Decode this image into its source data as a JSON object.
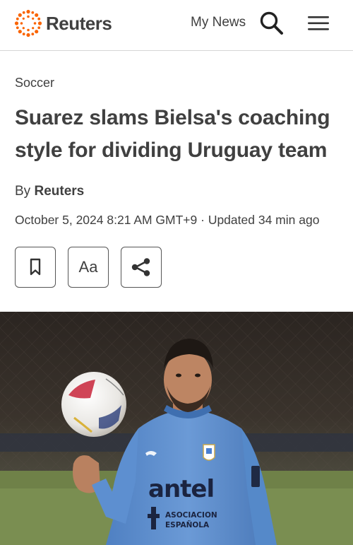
{
  "header": {
    "brand": "Reuters",
    "my_news": "My News",
    "icons": {
      "logo": "reuters-logo-icon",
      "search": "search-icon",
      "menu": "hamburger-menu-icon",
      "bookmark": "bookmark-icon",
      "share": "share-icon"
    }
  },
  "article": {
    "section": "Soccer",
    "headline": "Suarez slams Bielsa's coaching style for dividing Uruguay team",
    "byline_prefix": "By",
    "byline_author": "Reuters",
    "dateline": "October 5, 2024 8:21 AM GMT+9 · Updated 34 min ago",
    "font_button": "Aa"
  },
  "photo": {
    "shirt_sponsor": "antel",
    "shirt_text_line1": "ASOCIACION",
    "shirt_text_line2": "ESPAÑOLA"
  },
  "colors": {
    "logo_orange": "#fa6400",
    "text": "#404040",
    "shirt_blue": "#5d8fd0"
  }
}
